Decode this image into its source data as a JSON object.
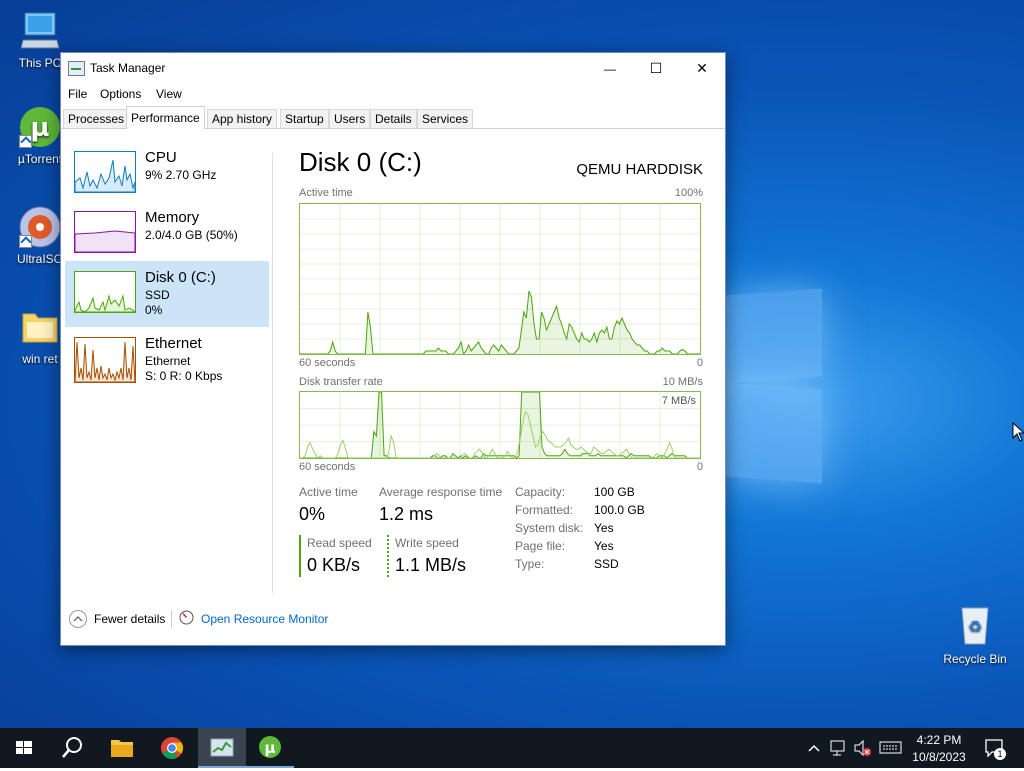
{
  "desktop": {
    "icons": [
      {
        "label": "This PC"
      },
      {
        "label": "µTorrent"
      },
      {
        "label": "UltraISO"
      },
      {
        "label": "win ret"
      },
      {
        "label": "Recycle Bin"
      }
    ]
  },
  "window": {
    "title": "Task Manager",
    "controls": {
      "minimize": "—",
      "maximize": "☐",
      "close": "✕"
    },
    "menu": [
      "File",
      "Options",
      "View"
    ],
    "tabs": [
      "Processes",
      "Performance",
      "App history",
      "Startup",
      "Users",
      "Details",
      "Services"
    ],
    "active_tab": "Performance"
  },
  "sidebar": {
    "items": [
      {
        "title": "CPU",
        "sub1": "9%  2.70 GHz",
        "sub2": "",
        "color": "#117dbb"
      },
      {
        "title": "Memory",
        "sub1": "2.0/4.0 GB (50%)",
        "sub2": "",
        "color": "#8b12ae"
      },
      {
        "title": "Disk 0 (C:)",
        "sub1": "SSD",
        "sub2": "0%",
        "color": "#4da60c"
      },
      {
        "title": "Ethernet",
        "sub1": "Ethernet",
        "sub2": "S: 0  R: 0 Kbps",
        "color": "#a74f01"
      }
    ]
  },
  "disk": {
    "title": "Disk 0 (C:)",
    "model": "QEMU HARDDISK",
    "graph1": {
      "label": "Active time",
      "max": "100%",
      "time": "60 seconds",
      "min": "0",
      "values": [
        0,
        0,
        0,
        0,
        0,
        0,
        0,
        0,
        0,
        0,
        0,
        0,
        2,
        8,
        2,
        0,
        0,
        0,
        0,
        0,
        0,
        0,
        0,
        0,
        0,
        0,
        0,
        28,
        18,
        0,
        0,
        0,
        0,
        0,
        0,
        0,
        0,
        0,
        0,
        0,
        0,
        0,
        0,
        0,
        0,
        0,
        0,
        0,
        0,
        0,
        2,
        2,
        2,
        2,
        2,
        4,
        2,
        2,
        2,
        0,
        0,
        0,
        2,
        4,
        8,
        0,
        2,
        6,
        2,
        4,
        6,
        8,
        4,
        2,
        0,
        0,
        4,
        6,
        4,
        2,
        6,
        4,
        2,
        0,
        0,
        0,
        2,
        4,
        16,
        28,
        24,
        42,
        38,
        20,
        10,
        10,
        28,
        24,
        16,
        20,
        24,
        28,
        32,
        24,
        20,
        14,
        10,
        20,
        18,
        14,
        10,
        8,
        14,
        10,
        10,
        8,
        10,
        14,
        8,
        14,
        16,
        14,
        18,
        10,
        10,
        18,
        22,
        20,
        24,
        20,
        16,
        14,
        10,
        8,
        6,
        6,
        4,
        2,
        2,
        0,
        0,
        0,
        2,
        2,
        4,
        2,
        2,
        2,
        0,
        0,
        0,
        2,
        3,
        2,
        0,
        0,
        0,
        0,
        0,
        0
      ]
    },
    "graph2": {
      "label": "Disk transfer rate",
      "max": "10 MB/s",
      "secondary_max": "7 MB/s",
      "time": "60 seconds",
      "min": "0",
      "read_values": [
        0,
        0,
        2,
        10,
        14,
        8,
        4,
        0,
        2,
        0,
        0,
        0,
        0,
        0,
        0,
        4,
        12,
        16,
        8,
        0,
        0,
        0,
        0,
        0,
        0,
        0,
        0,
        0,
        0,
        0,
        0,
        0,
        0,
        0,
        0,
        4,
        20,
        14,
        0,
        0,
        0,
        0,
        0,
        0,
        0,
        0,
        0,
        0,
        0,
        0,
        0,
        0,
        0,
        2,
        4,
        2,
        0,
        0,
        0,
        0,
        0,
        0,
        0,
        0,
        2,
        4,
        2,
        0,
        0,
        4,
        6,
        8,
        4,
        0,
        0,
        4,
        8,
        4,
        0,
        0,
        0,
        2,
        6,
        2,
        0,
        0,
        6,
        18,
        32,
        42,
        40,
        30,
        20,
        10,
        12,
        20,
        24,
        20,
        16,
        14,
        12,
        10,
        10,
        10,
        12,
        14,
        18,
        12,
        10,
        8,
        8,
        10,
        8,
        6,
        4,
        4,
        10,
        8,
        6,
        4,
        4,
        6,
        8,
        6,
        4,
        2,
        2,
        4,
        6,
        8,
        4,
        0,
        0,
        0,
        0,
        0,
        0,
        0,
        0,
        0,
        2,
        4,
        2,
        0,
        4,
        8,
        14,
        8,
        0,
        0,
        0,
        0,
        0,
        0,
        0,
        0,
        0,
        0,
        0
      ],
      "write_values": [
        0,
        0,
        0,
        0,
        0,
        0,
        0,
        0,
        0,
        0,
        0,
        0,
        0,
        0,
        0,
        0,
        0,
        0,
        0,
        0,
        0,
        0,
        0,
        0,
        0,
        0,
        0,
        0,
        0,
        24,
        20,
        60,
        60,
        2,
        2,
        0,
        0,
        0,
        0,
        0,
        0,
        0,
        0,
        0,
        0,
        0,
        0,
        0,
        0,
        0,
        0,
        0,
        2,
        2,
        0,
        0,
        2,
        2,
        0,
        0,
        4,
        2,
        0,
        2,
        0,
        2,
        0,
        0,
        0,
        2,
        0,
        0,
        4,
        2,
        2,
        2,
        2,
        2,
        2,
        2,
        2,
        2,
        2,
        2,
        2,
        0,
        2,
        60,
        60,
        60,
        60,
        60,
        60,
        60,
        60,
        10,
        4,
        2,
        2,
        2,
        2,
        2,
        2,
        4,
        8,
        4,
        2,
        2,
        2,
        2,
        2,
        4,
        4,
        4,
        2,
        2,
        2,
        4,
        2,
        2,
        2,
        2,
        2,
        2,
        2,
        2,
        2,
        2,
        0,
        2,
        4,
        2,
        2,
        2,
        2,
        2,
        2,
        2,
        0,
        0,
        0,
        2,
        2,
        2,
        0,
        2,
        4,
        2,
        2,
        2,
        2,
        2,
        0,
        0,
        0,
        0,
        0,
        0
      ]
    },
    "stats": {
      "active_time_label": "Active time",
      "active_time": "0%",
      "avg_response_label": "Average response time",
      "avg_response": "1.2 ms",
      "read_label": "Read speed",
      "read": "0 KB/s",
      "write_label": "Write speed",
      "write": "1.1 MB/s"
    },
    "properties": [
      {
        "k": "Capacity:",
        "v": "100 GB"
      },
      {
        "k": "Formatted:",
        "v": "100.0 GB"
      },
      {
        "k": "System disk:",
        "v": "Yes"
      },
      {
        "k": "Page file:",
        "v": "Yes"
      },
      {
        "k": "Type:",
        "v": "SSD"
      }
    ]
  },
  "footer": {
    "fewer_details": "Fewer details",
    "open_monitor": "Open Resource Monitor"
  },
  "taskbar": {
    "time": "4:22 PM",
    "date": "10/8/2023",
    "notification_count": "1",
    "apps": [
      "start-icon",
      "search-icon",
      "file-explorer-icon",
      "chrome-icon",
      "task-manager-icon",
      "utorrent-icon"
    ]
  },
  "colors": {
    "accent_green": "#4da60c",
    "selected_bg": "#cce4f7",
    "link_blue": "#0066cc"
  }
}
